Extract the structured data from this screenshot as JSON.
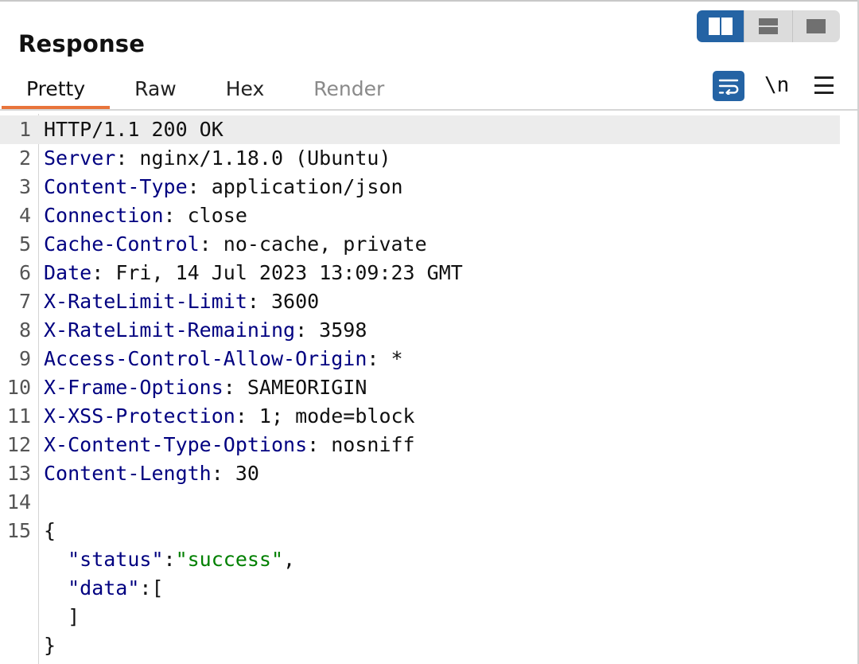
{
  "header": {
    "title": "Response"
  },
  "layout_buttons": [
    {
      "name": "side-by-side",
      "active": true
    },
    {
      "name": "stacked",
      "active": false
    },
    {
      "name": "single",
      "active": false
    }
  ],
  "tabs": [
    {
      "label": "Pretty",
      "active": true,
      "enabled": true
    },
    {
      "label": "Raw",
      "active": false,
      "enabled": true
    },
    {
      "label": "Hex",
      "active": false,
      "enabled": true
    },
    {
      "label": "Render",
      "active": false,
      "enabled": false
    }
  ],
  "toolbar": {
    "word_wrap_icon": "wrap-icon",
    "newline_label": "\\n",
    "menu_icon": "hamburger-menu-icon"
  },
  "colors": {
    "accent": "#2463a4",
    "tab_underline": "#e8743b",
    "header_key": "#000080",
    "json_string": "#008000"
  },
  "editor": {
    "lines": [
      {
        "num": "1",
        "segments": [
          {
            "t": "HTTP/1.1 200 OK",
            "c": ""
          }
        ]
      },
      {
        "num": "2",
        "segments": [
          {
            "t": "Server",
            "c": "hk"
          },
          {
            "t": ": nginx/1.18.0 (Ubuntu)",
            "c": ""
          }
        ]
      },
      {
        "num": "3",
        "segments": [
          {
            "t": "Content-Type",
            "c": "hk"
          },
          {
            "t": ": application/json",
            "c": ""
          }
        ]
      },
      {
        "num": "4",
        "segments": [
          {
            "t": "Connection",
            "c": "hk"
          },
          {
            "t": ": close",
            "c": ""
          }
        ]
      },
      {
        "num": "5",
        "segments": [
          {
            "t": "Cache-Control",
            "c": "hk"
          },
          {
            "t": ": no-cache, private",
            "c": ""
          }
        ]
      },
      {
        "num": "6",
        "segments": [
          {
            "t": "Date",
            "c": "hk"
          },
          {
            "t": ": Fri, 14 Jul 2023 13:09:23 GMT",
            "c": ""
          }
        ]
      },
      {
        "num": "7",
        "segments": [
          {
            "t": "X-RateLimit-Limit",
            "c": "hk"
          },
          {
            "t": ": 3600",
            "c": ""
          }
        ]
      },
      {
        "num": "8",
        "segments": [
          {
            "t": "X-RateLimit-Remaining",
            "c": "hk"
          },
          {
            "t": ": 3598",
            "c": ""
          }
        ]
      },
      {
        "num": "9",
        "segments": [
          {
            "t": "Access-Control-Allow-Origin",
            "c": "hk"
          },
          {
            "t": ": *",
            "c": ""
          }
        ]
      },
      {
        "num": "10",
        "segments": [
          {
            "t": "X-Frame-Options",
            "c": "hk"
          },
          {
            "t": ": SAMEORIGIN",
            "c": ""
          }
        ]
      },
      {
        "num": "11",
        "segments": [
          {
            "t": "X-XSS-Protection",
            "c": "hk"
          },
          {
            "t": ": 1; mode=block",
            "c": ""
          }
        ]
      },
      {
        "num": "12",
        "segments": [
          {
            "t": "X-Content-Type-Options",
            "c": "hk"
          },
          {
            "t": ": nosniff",
            "c": ""
          }
        ]
      },
      {
        "num": "13",
        "segments": [
          {
            "t": "Content-Length",
            "c": "hk"
          },
          {
            "t": ": 30",
            "c": ""
          }
        ]
      },
      {
        "num": "14",
        "segments": []
      },
      {
        "num": "15",
        "segments": [
          {
            "t": "{",
            "c": ""
          }
        ]
      },
      {
        "num": "",
        "segments": [
          {
            "t": "  \"status\"",
            "c": "hk"
          },
          {
            "t": ":",
            "c": ""
          },
          {
            "t": "\"success\"",
            "c": "js"
          },
          {
            "t": ",",
            "c": ""
          }
        ]
      },
      {
        "num": "",
        "segments": [
          {
            "t": "  \"data\"",
            "c": "hk"
          },
          {
            "t": ":[",
            "c": ""
          }
        ]
      },
      {
        "num": "",
        "segments": [
          {
            "t": "  ]",
            "c": ""
          }
        ]
      },
      {
        "num": "",
        "segments": [
          {
            "t": "}",
            "c": ""
          }
        ]
      }
    ]
  }
}
